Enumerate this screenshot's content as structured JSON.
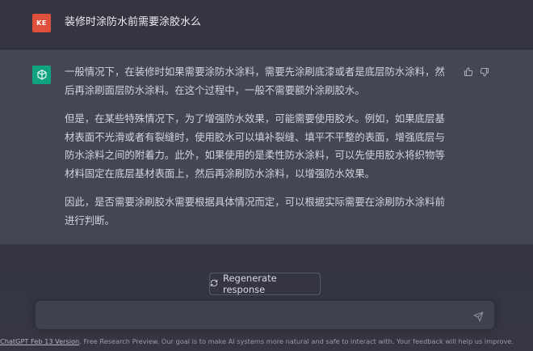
{
  "user": {
    "avatar_initials": "KE",
    "message": "装修时涂防水前需要涂胶水么"
  },
  "assistant": {
    "paragraphs": [
      "一般情况下，在装修时如果需要涂防水涂料，需要先涂刷底漆或者是底层防水涂料，然后再涂刷面层防水涂料。在这个过程中，一般不需要额外涂刷胶水。",
      "但是，在某些特殊情况下，为了增强防水效果，可能需要使用胶水。例如，如果底层基材表面不光滑或者有裂缝时，使用胶水可以填补裂缝、填平不平整的表面，增强底层与防水涂料之间的附着力。此外，如果使用的是柔性防水涂料，可以先使用胶水将织物等材料固定在底层基材表面上，然后再涂刷防水涂料，以增强防水效果。",
      "因此，是否需要涂刷胶水需要根据具体情况而定，可以根据实际需要在涂刷防水涂料前进行判断。"
    ],
    "icons": {
      "avatar": "openai-logo-icon",
      "like": "thumbs-up-icon",
      "dislike": "thumbs-down-icon"
    }
  },
  "controls": {
    "regenerate_label": "Regenerate response",
    "input_value": "",
    "input_placeholder": ""
  },
  "footer": {
    "version_link": "ChatGPT Feb 13 Version",
    "text": ". Free Research Preview. Our goal is to make AI systems more natural and safe to interact with. Your feedback will help us improve."
  },
  "colors": {
    "background": "#343541",
    "assistant_background": "#444654",
    "user_avatar": "#e0513d",
    "gpt_avatar": "#10a37f"
  }
}
